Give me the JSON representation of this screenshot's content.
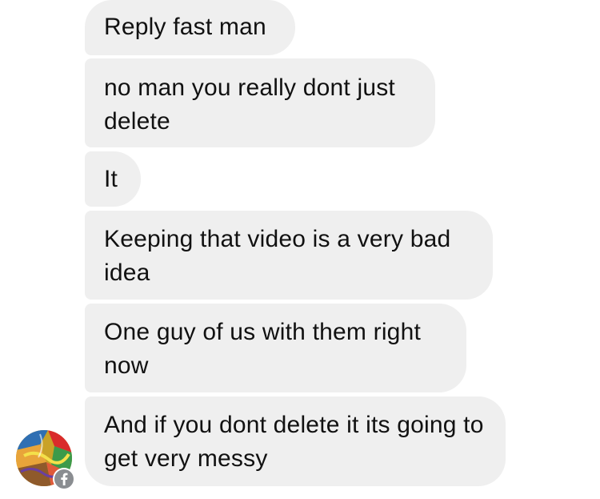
{
  "messages": [
    {
      "text": "Reply fast man"
    },
    {
      "text": "no man you really dont just delete"
    },
    {
      "text": "It"
    },
    {
      "text": "Keeping that video is a very bad idea"
    },
    {
      "text": "One guy of us with them right now"
    },
    {
      "text": "And if you dont delete it its going to get very messy"
    }
  ],
  "colors": {
    "bubble_background": "#efefef",
    "text": "#111111",
    "badge": "#8a8d91"
  },
  "icons": {
    "sender_avatar": "avatar",
    "platform_badge": "facebook-icon"
  }
}
